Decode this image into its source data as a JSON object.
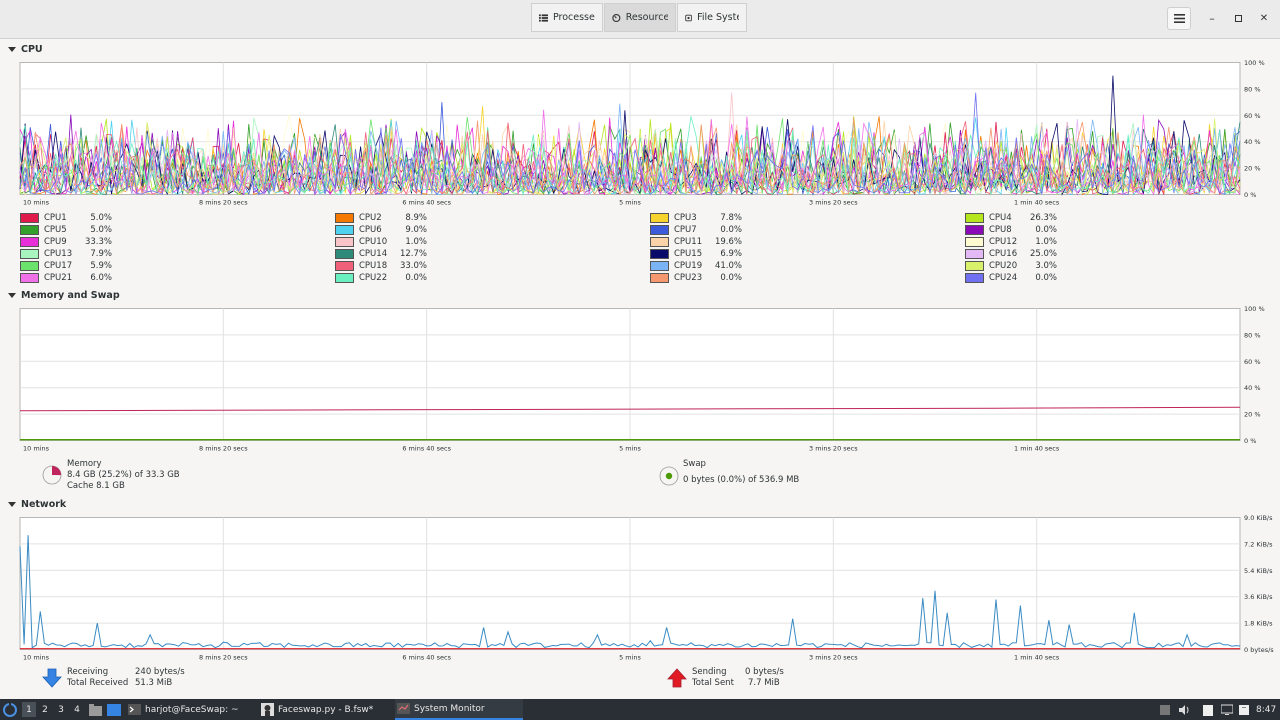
{
  "header": {
    "tabs": [
      {
        "label": "Processes",
        "icon": "list-icon"
      },
      {
        "label": "Resources",
        "icon": "gauge-icon"
      },
      {
        "label": "File Systems",
        "icon": "disk-icon"
      }
    ],
    "active_tab": 1
  },
  "sections": {
    "cpu": "CPU",
    "memory": "Memory and Swap",
    "network": "Network"
  },
  "time_axis": [
    "10 mins",
    "8 mins 20 secs",
    "6 mins 40 secs",
    "5 mins",
    "3 mins 20 secs",
    "1 min 40 secs"
  ],
  "pct_axis": [
    "100 %",
    "80 %",
    "60 %",
    "40 %",
    "20 %",
    "0 %"
  ],
  "net_axis": [
    "9.0 KiB/s",
    "7.2 KiB/s",
    "5.4 KiB/s",
    "3.6 KiB/s",
    "1.8 KiB/s",
    "0 bytes/s"
  ],
  "cpus": [
    {
      "name": "CPU1",
      "pct": "5.0%",
      "color": "#e01b4c"
    },
    {
      "name": "CPU2",
      "pct": "8.9%",
      "color": "#f57900"
    },
    {
      "name": "CPU3",
      "pct": "7.8%",
      "color": "#f6d32d"
    },
    {
      "name": "CPU4",
      "pct": "26.3%",
      "color": "#b5e61d"
    },
    {
      "name": "CPU5",
      "pct": "5.0%",
      "color": "#33a02c"
    },
    {
      "name": "CPU6",
      "pct": "9.0%",
      "color": "#4fd2f0"
    },
    {
      "name": "CPU7",
      "pct": "0.0%",
      "color": "#3b5bdb"
    },
    {
      "name": "CPU8",
      "pct": "0.0%",
      "color": "#8a0ab8"
    },
    {
      "name": "CPU9",
      "pct": "33.3%",
      "color": "#e830d8"
    },
    {
      "name": "CPU10",
      "pct": "1.0%",
      "color": "#f8c4c8"
    },
    {
      "name": "CPU11",
      "pct": "19.6%",
      "color": "#fcd3a8"
    },
    {
      "name": "CPU12",
      "pct": "1.0%",
      "color": "#fffbd0"
    },
    {
      "name": "CPU13",
      "pct": "7.9%",
      "color": "#a8f5c0"
    },
    {
      "name": "CPU14",
      "pct": "12.7%",
      "color": "#2e8b7a"
    },
    {
      "name": "CPU15",
      "pct": "6.9%",
      "color": "#0a0a6a"
    },
    {
      "name": "CPU16",
      "pct": "25.0%",
      "color": "#e2b8f5"
    },
    {
      "name": "CPU17",
      "pct": "5.9%",
      "color": "#6be26b"
    },
    {
      "name": "CPU18",
      "pct": "33.0%",
      "color": "#f06078"
    },
    {
      "name": "CPU19",
      "pct": "41.0%",
      "color": "#7ab4f5"
    },
    {
      "name": "CPU20",
      "pct": "3.0%",
      "color": "#d8f06a"
    },
    {
      "name": "CPU21",
      "pct": "6.0%",
      "color": "#f070e8"
    },
    {
      "name": "CPU22",
      "pct": "0.0%",
      "color": "#6af0c0"
    },
    {
      "name": "CPU23",
      "pct": "0.0%",
      "color": "#f59870"
    },
    {
      "name": "CPU24",
      "pct": "0.0%",
      "color": "#7070f0"
    }
  ],
  "memory": {
    "label": "Memory",
    "value": "8.4 GB (25.2%) of 33.3 GB",
    "cache": "Cache 8.1 GB",
    "color": "#c0245c",
    "fraction": 0.252
  },
  "swap": {
    "label": "Swap",
    "value": "0 bytes (0.0%) of 536.9 MB",
    "color": "#4e9a06",
    "fraction": 0.0
  },
  "network": {
    "receiving_label": "Receiving",
    "receiving_rate": "240 bytes/s",
    "total_received_label": "Total Received",
    "total_received": "51.3 MiB",
    "sending_label": "Sending",
    "sending_rate": "0 bytes/s",
    "total_sent_label": "Total Sent",
    "total_sent": "7.7 MiB",
    "recv_color": "#3584e4",
    "send_color": "#e01b24"
  },
  "chart_data": [
    {
      "type": "line",
      "title": "CPU",
      "x": [
        "10 mins",
        "8 mins 20 secs",
        "6 mins 40 secs",
        "5 mins",
        "3 mins 20 secs",
        "1 min 40 secs"
      ],
      "ylim": [
        0,
        100
      ],
      "series_summary": "24 CPU series, mostly oscillating between 0% and 60%, occasional peaks to ~90%",
      "grid": true
    },
    {
      "type": "line",
      "title": "Memory and Swap",
      "ylim": [
        0,
        100
      ],
      "series": [
        {
          "name": "Memory",
          "values": [
            22.5,
            23,
            23.5,
            24,
            24.5,
            25.2
          ]
        },
        {
          "name": "Swap",
          "values": [
            0,
            0,
            0,
            0,
            0,
            0
          ]
        }
      ],
      "grid": true
    },
    {
      "type": "line",
      "title": "Network",
      "ylim": [
        0,
        9.0
      ],
      "series": [
        {
          "name": "Receiving",
          "values_kib": [
            7.8,
            0.3,
            1.8,
            0.3,
            0.2,
            0.3,
            0.4,
            4.1,
            2.9,
            2.6,
            2.2,
            0.3,
            0.2,
            3.0,
            0.3,
            2.3,
            0.3,
            1.1,
            0.3,
            0.24
          ]
        },
        {
          "name": "Sending",
          "values_kib": [
            0,
            0,
            0,
            0,
            0,
            0,
            0,
            0,
            0,
            0,
            0,
            0,
            0,
            0,
            0,
            0,
            0,
            0,
            0,
            0
          ]
        }
      ],
      "grid": true
    }
  ],
  "taskbar": {
    "workspaces": [
      "1",
      "2",
      "3",
      "4"
    ],
    "active_workspace": 0,
    "windows": [
      {
        "label": "harjot@FaceSwap: ~",
        "icon": "terminal-icon"
      },
      {
        "label": "Faceswap.py - B.fsw*",
        "icon": "app-icon"
      },
      {
        "label": "System Monitor",
        "icon": "monitor-icon"
      }
    ],
    "clock": "8:47"
  }
}
